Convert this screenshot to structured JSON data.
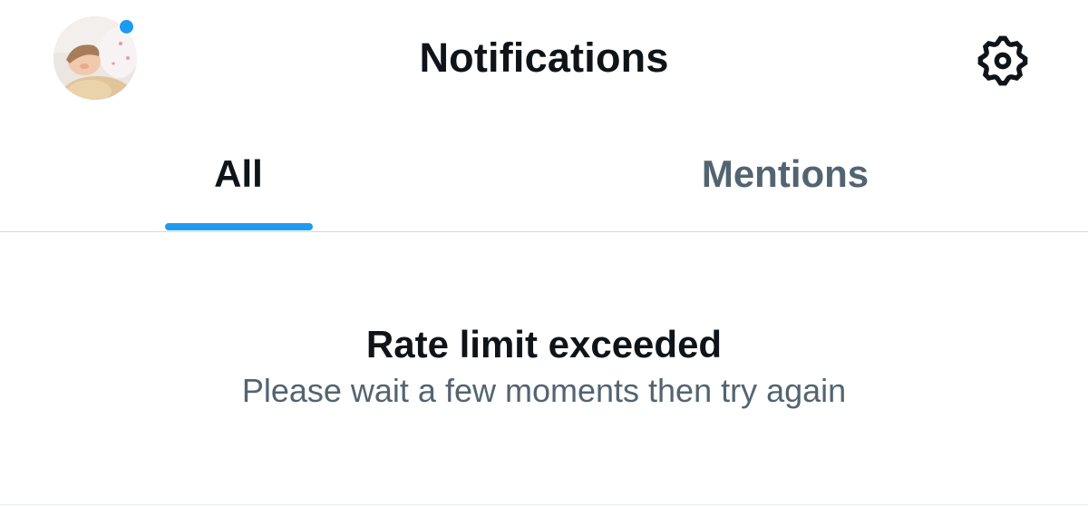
{
  "header": {
    "title": "Notifications",
    "avatar_icon": "profile-avatar",
    "has_unread_dot": true,
    "settings_icon": "gear-icon"
  },
  "tabs": [
    {
      "label": "All",
      "selected": true
    },
    {
      "label": "Mentions",
      "selected": false
    }
  ],
  "message": {
    "title": "Rate limit exceeded",
    "subtitle": "Please wait a few moments then try again"
  },
  "colors": {
    "accent": "#1d9bf0",
    "text_primary": "#0f1419",
    "text_secondary": "#536471",
    "divider": "#cfd9de"
  }
}
